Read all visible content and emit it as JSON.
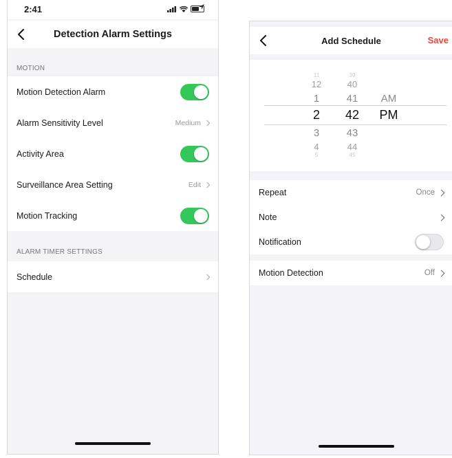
{
  "left": {
    "status": {
      "time": "2:41"
    },
    "title": "Detection Alarm Settings",
    "sections": {
      "motion": "MOTION",
      "timer": "ALARM TIMER SETTINGS"
    },
    "rows": {
      "motion_alarm": {
        "label": "Motion Detection Alarm"
      },
      "sensitivity": {
        "label": "Alarm Sensitivity Level",
        "value": "Medium"
      },
      "activity": {
        "label": "Activity Area"
      },
      "surveillance": {
        "label": "Surveillance Area Setting",
        "value": "Edit"
      },
      "tracking": {
        "label": "Motion Tracking"
      },
      "schedule": {
        "label": "Schedule"
      }
    },
    "toggles": {
      "motion_alarm": true,
      "activity": true,
      "tracking": true
    }
  },
  "right": {
    "title": "Add Schedule",
    "save_label": "Save",
    "picker": {
      "hours": [
        "11",
        "12",
        "1",
        "2",
        "3",
        "4",
        "5"
      ],
      "minutes": [
        "39",
        "40",
        "41",
        "42",
        "43",
        "44",
        "45"
      ],
      "periods": [
        "AM",
        "PM"
      ],
      "selected": {
        "hour": "2",
        "minute": "42",
        "period": "PM"
      }
    },
    "rows": {
      "repeat": {
        "label": "Repeat",
        "value": "Once"
      },
      "note": {
        "label": "Note"
      },
      "notification": {
        "label": "Notification"
      },
      "motion_detection": {
        "label": "Motion Detection",
        "value": "Off"
      }
    },
    "toggles": {
      "notification": false
    }
  },
  "colors": {
    "toggle_on": "#34c759",
    "save": "#e8463a",
    "background": "#f4f4f6"
  }
}
